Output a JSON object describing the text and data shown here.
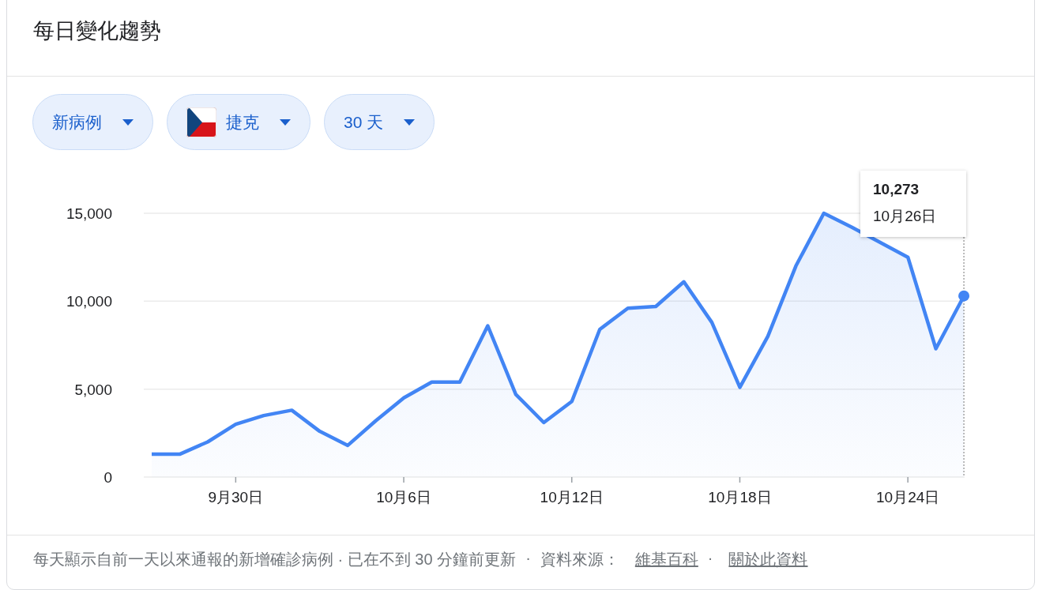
{
  "title": "每日變化趨勢",
  "filters": [
    {
      "kind": "plain",
      "label": "新病例"
    },
    {
      "kind": "flag",
      "label": "捷克"
    },
    {
      "kind": "plain",
      "label": "30 天"
    }
  ],
  "chart": {
    "chart_data": {
      "type": "area",
      "categories": [
        null,
        null,
        null,
        "9月30日",
        null,
        null,
        null,
        null,
        null,
        "10月6日",
        null,
        null,
        null,
        null,
        null,
        "10月12日",
        null,
        null,
        null,
        null,
        null,
        "10月18日",
        null,
        null,
        null,
        null,
        null,
        "10月24日",
        null,
        null
      ],
      "series": [
        {
          "color": "#4285f4",
          "values": [
            1300,
            1300,
            2000,
            3000,
            3500,
            3800,
            2600,
            1800,
            3200,
            4500,
            5400,
            5400,
            8600,
            4700,
            3100,
            4300,
            8400,
            9600,
            9700,
            11100,
            8800,
            5100,
            8000,
            12000,
            15000,
            14200,
            null,
            12500,
            7300,
            10300
          ]
        }
      ],
      "ylim": [
        0,
        15000
      ],
      "yticks": [
        {
          "value": 0,
          "label": "0"
        },
        {
          "value": 5000,
          "label": "5,000"
        },
        {
          "value": 10000,
          "label": "10,000"
        },
        {
          "value": 15000,
          "label": "15,000"
        }
      ]
    },
    "tooltip": {
      "value": "10,273",
      "date": "10月26日"
    }
  },
  "footer": [
    {
      "kind": "text",
      "text": "每天顯示自前一天以來通報的新增確診病例 · 已在不到 30 分鐘前更新"
    },
    {
      "kind": "separator",
      "text": "·"
    },
    {
      "kind": "text",
      "text": "資料來源："
    },
    {
      "kind": "link",
      "text": "維基百科"
    },
    {
      "kind": "separator",
      "text": "·"
    },
    {
      "kind": "link",
      "text": "關於此資料"
    }
  ]
}
